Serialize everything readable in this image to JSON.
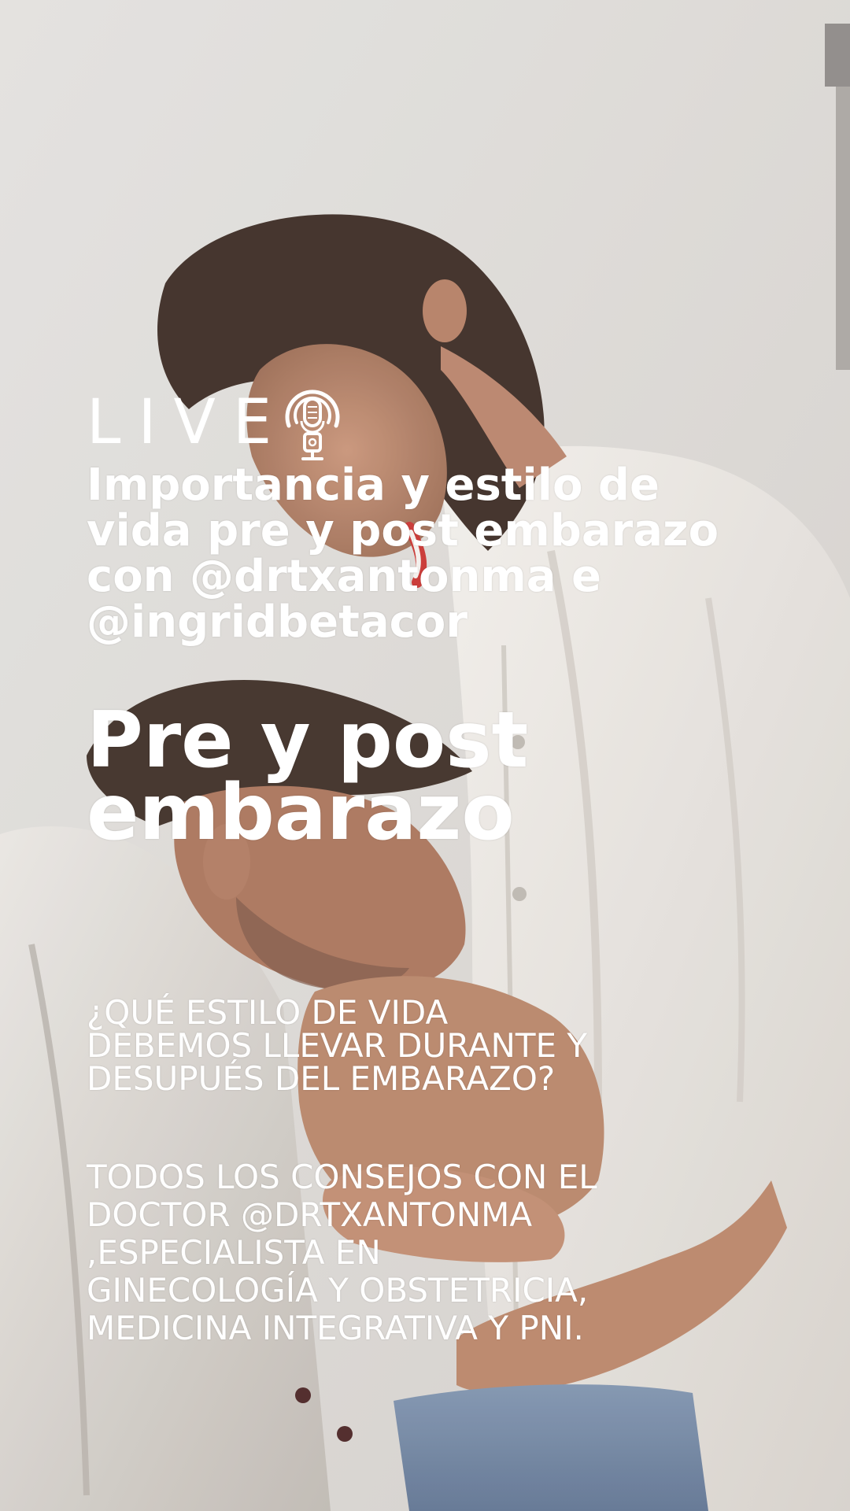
{
  "live": {
    "label": "LIVE",
    "icon": "podcast-microphone-icon"
  },
  "headline": {
    "lines": [
      "Importancia y estilo de",
      "vida pre y post embarazo",
      "con @drtxantonma e",
      "@ingridbetacor"
    ]
  },
  "big_title": {
    "lines": [
      "Pre y post",
      "embarazo"
    ]
  },
  "question": {
    "lines": [
      "¿QUÉ ESTILO DE VIDA",
      "DEBEMOS LLEVAR DURANTE Y",
      "DESUPUÉS DEL  EMBARAZO?"
    ]
  },
  "advice": {
    "lines": [
      "TODOS LOS CONSEJOS CON EL",
      "DOCTOR @DRTXANTONMA",
      ",ESPECIALISTA EN",
      "GINECOLOGÍA Y OBSTETRICIA,",
      "MEDICINA INTEGRATIVA Y PNI."
    ]
  },
  "colors": {
    "text": "#ffffff",
    "wall": "#dcd9d6",
    "shirt": "#ece9e5",
    "hair": "#3a2a22",
    "skin": "#b98468",
    "jeans": "#6f83a0"
  }
}
